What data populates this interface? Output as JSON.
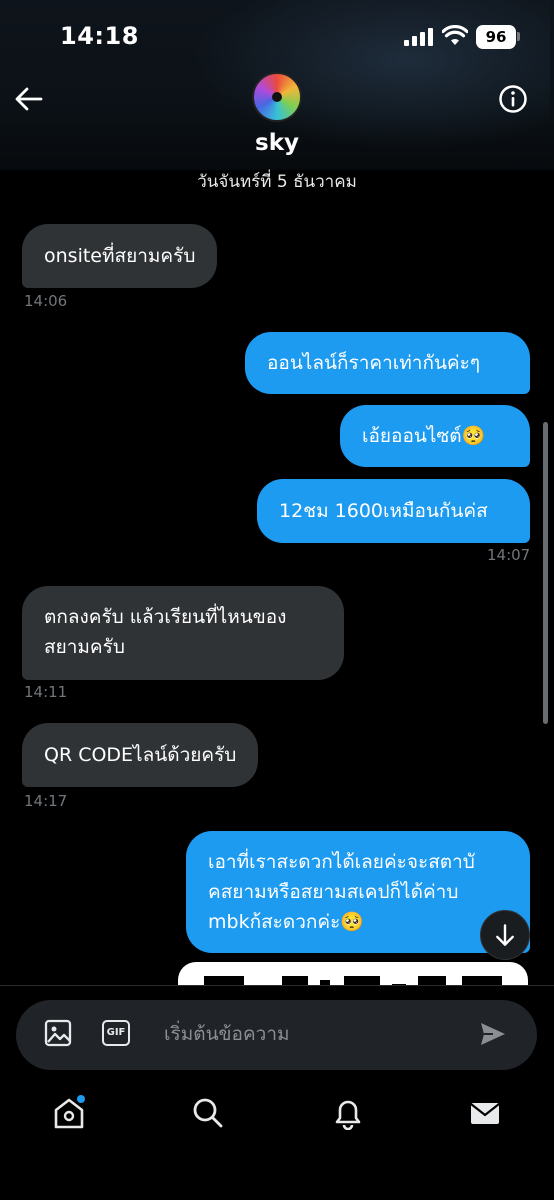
{
  "status_bar": {
    "time": "14:18",
    "battery": "96"
  },
  "header": {
    "contact_name": "sky",
    "date": "วันจันทร์ที่ 5 ธันวาคม"
  },
  "messages": [
    {
      "direction": "incoming",
      "text": "onsiteที่สยามครับ",
      "time": "14:06"
    },
    {
      "direction": "outgoing",
      "text": "ออนไลน์ก็ราคาเท่ากันค่ะๆ"
    },
    {
      "direction": "outgoing",
      "text": "เอ้ยออนไซต์🥺"
    },
    {
      "direction": "outgoing",
      "text": "12ชม 1600เหมือนกันค่ส",
      "time": "14:07"
    },
    {
      "direction": "incoming",
      "lines": [
        "ตกลงครับ แล้วเรียนที่ไหนของ",
        "สยามครับ"
      ],
      "time": "14:11"
    },
    {
      "direction": "incoming",
      "text": "QR CODEไลน์ด้วยครับ",
      "time": "14:17"
    },
    {
      "direction": "outgoing",
      "lines": [
        "เอาที่เราสะดวกได้เลยค่ะจะสตาบั",
        "คสยามหรือสยามสเคปก็ได้ค่าบ",
        "mbkก้สะดวกค่ะ🥺"
      ]
    }
  ],
  "composer": {
    "placeholder": "เริ่มต้นข้อความ",
    "gif_label": "GIF"
  },
  "icons": {
    "back": "arrow-left-icon",
    "info": "info-circle-icon",
    "image": "image-icon",
    "gif": "gif-icon",
    "send": "send-icon",
    "scroll_down": "arrow-down-icon",
    "nav": [
      "home-icon",
      "search-icon",
      "bell-icon",
      "mail-icon"
    ]
  },
  "colors": {
    "accent": "#1d9bf0",
    "incoming_bubble": "#2f3336",
    "background": "#000000"
  }
}
